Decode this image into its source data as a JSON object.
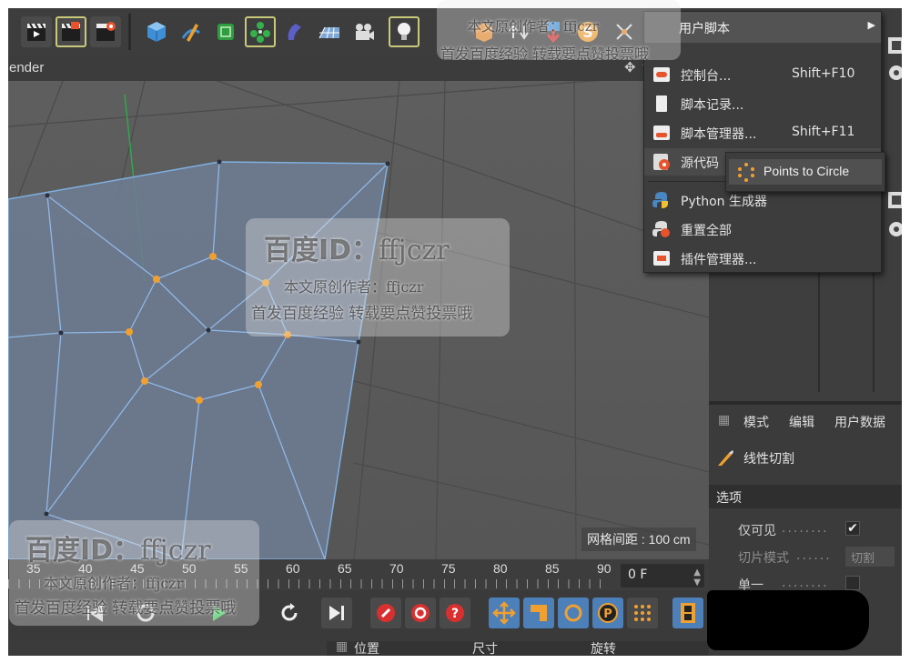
{
  "viewport": {
    "render_label": "ender",
    "grid_spacing": "网格间距 : 100 cm"
  },
  "menu": {
    "header": "用户脚本",
    "items": [
      {
        "label": "控制台...",
        "shortcut": "Shift+F10",
        "icon": "console-icon"
      },
      {
        "label": "脚本记录...",
        "shortcut": "",
        "icon": "script-log-icon"
      },
      {
        "label": "脚本管理器...",
        "shortcut": "Shift+F11",
        "icon": "script-manager-icon"
      },
      {
        "label": "源代码",
        "shortcut": "",
        "icon": "source-code-icon"
      },
      {
        "label": "Python 生成器",
        "shortcut": "",
        "icon": "python-icon"
      },
      {
        "label": "重置全部",
        "shortcut": "",
        "icon": "python-reset-icon"
      },
      {
        "label": "插件管理器...",
        "shortcut": "",
        "icon": "plugin-manager-icon"
      }
    ],
    "submenu": {
      "label": "Points to Circle",
      "icon": "points-circle-icon"
    }
  },
  "attributes": {
    "tabs": [
      "模式",
      "编辑",
      "用户数据"
    ],
    "tool_name": "线性切割",
    "section": "选项",
    "rows": [
      {
        "label": "仅可见",
        "control": "checkbox",
        "checked": true
      },
      {
        "label": "切片模式",
        "control": "dropdown",
        "value": "切割"
      },
      {
        "label": "单一",
        "control": "checkbox",
        "checked": false
      }
    ]
  },
  "timeline": {
    "ticks": [
      "35",
      "40",
      "45",
      "50",
      "55",
      "60",
      "65",
      "70",
      "75",
      "80",
      "85",
      "90"
    ],
    "current_frame": "0 F"
  },
  "coord_bar": {
    "labels": [
      "位置",
      "尺寸",
      "旋转"
    ]
  },
  "watermark": {
    "id_label": "百度ID：",
    "id_name": "ffjczr",
    "author_line": "本文原创作者：ffjczr",
    "promo_line": "首发百度经验 转载要点赞投票哦"
  }
}
